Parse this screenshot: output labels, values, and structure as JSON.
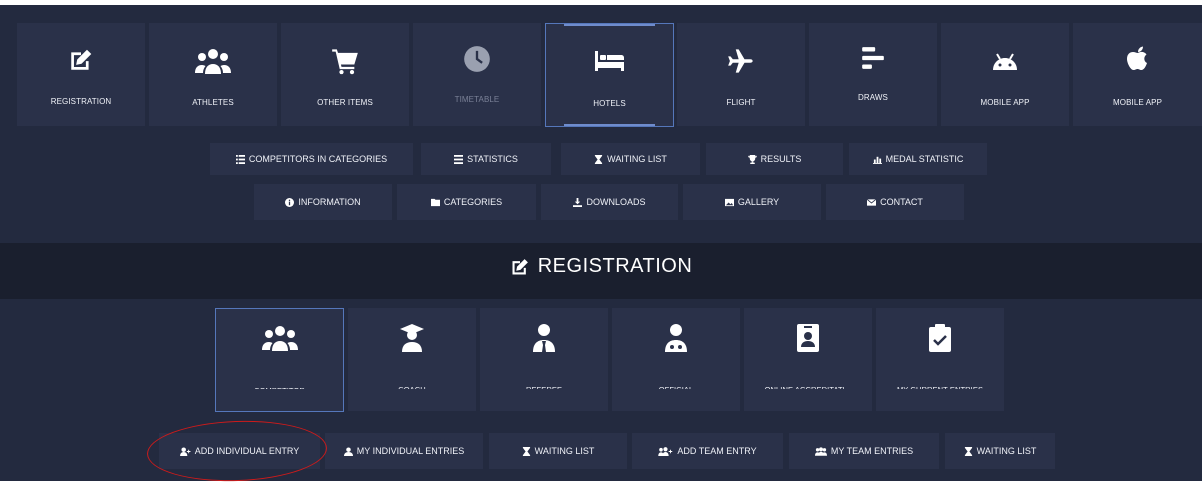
{
  "top_nav": {
    "tiles": [
      {
        "label": "REGISTRATION",
        "icon": "edit-icon"
      },
      {
        "label": "ATHLETES",
        "icon": "users-icon"
      },
      {
        "label": "OTHER ITEMS",
        "icon": "cart-icon"
      },
      {
        "label": "TIMETABLE",
        "icon": "clock-icon",
        "state": "disabled"
      },
      {
        "label": "HOTELS",
        "icon": "bed-icon",
        "state": "active"
      },
      {
        "label": "FLIGHT",
        "icon": "plane-icon"
      },
      {
        "label": "DRAWS",
        "icon": "bracket-icon"
      },
      {
        "label": "MOBILE APP",
        "icon": "android-icon"
      },
      {
        "label": "MOBILE APP",
        "icon": "apple-icon"
      }
    ],
    "row1": [
      {
        "label": "COMPETITORS IN CATEGORIES",
        "icon": "list-ordered-icon"
      },
      {
        "label": "STATISTICS",
        "icon": "list-icon"
      },
      {
        "label": "WAITING LIST",
        "icon": "hourglass-icon"
      },
      {
        "label": "RESULTS",
        "icon": "trophy-icon"
      },
      {
        "label": "MEDAL STATISTIC",
        "icon": "bar-chart-icon"
      }
    ],
    "row2": [
      {
        "label": "INFORMATION",
        "icon": "info-icon"
      },
      {
        "label": "CATEGORIES",
        "icon": "folder-icon"
      },
      {
        "label": "DOWNLOADS",
        "icon": "download-icon"
      },
      {
        "label": "GALLERY",
        "icon": "image-icon"
      },
      {
        "label": "CONTACT",
        "icon": "envelope-icon"
      }
    ]
  },
  "section": {
    "title": "REGISTRATION",
    "icon": "edit-icon"
  },
  "registration_tiles": [
    {
      "label": "COMPETITOR",
      "icon": "users-icon",
      "state": "active"
    },
    {
      "label": "COACH",
      "icon": "graduate-icon"
    },
    {
      "label": "REFEREE",
      "icon": "referee-icon"
    },
    {
      "label": "OFFICIAL",
      "icon": "official-icon"
    },
    {
      "label": "ONLINE ACCREDITATI...",
      "icon": "id-badge-icon"
    },
    {
      "label": "MY CURRENT ENTRIES",
      "icon": "clipboard-check-icon"
    }
  ],
  "entry_actions": [
    {
      "label": "ADD INDIVIDUAL ENTRY",
      "icon": "user-plus-icon",
      "highlighted": true
    },
    {
      "label": "MY INDIVIDUAL ENTRIES",
      "icon": "user-icon"
    },
    {
      "label": "WAITING LIST",
      "icon": "hourglass-icon"
    },
    {
      "label": "ADD TEAM ENTRY",
      "icon": "users-plus-icon"
    },
    {
      "label": "MY TEAM ENTRIES",
      "icon": "users-icon"
    },
    {
      "label": "WAITING LIST",
      "icon": "hourglass-icon"
    }
  ],
  "colors": {
    "background": "#232a3f",
    "tile": "#2a3149",
    "band": "#1a1f2e",
    "active_border": "#5577bb",
    "annotation": "#cc1b1b"
  }
}
